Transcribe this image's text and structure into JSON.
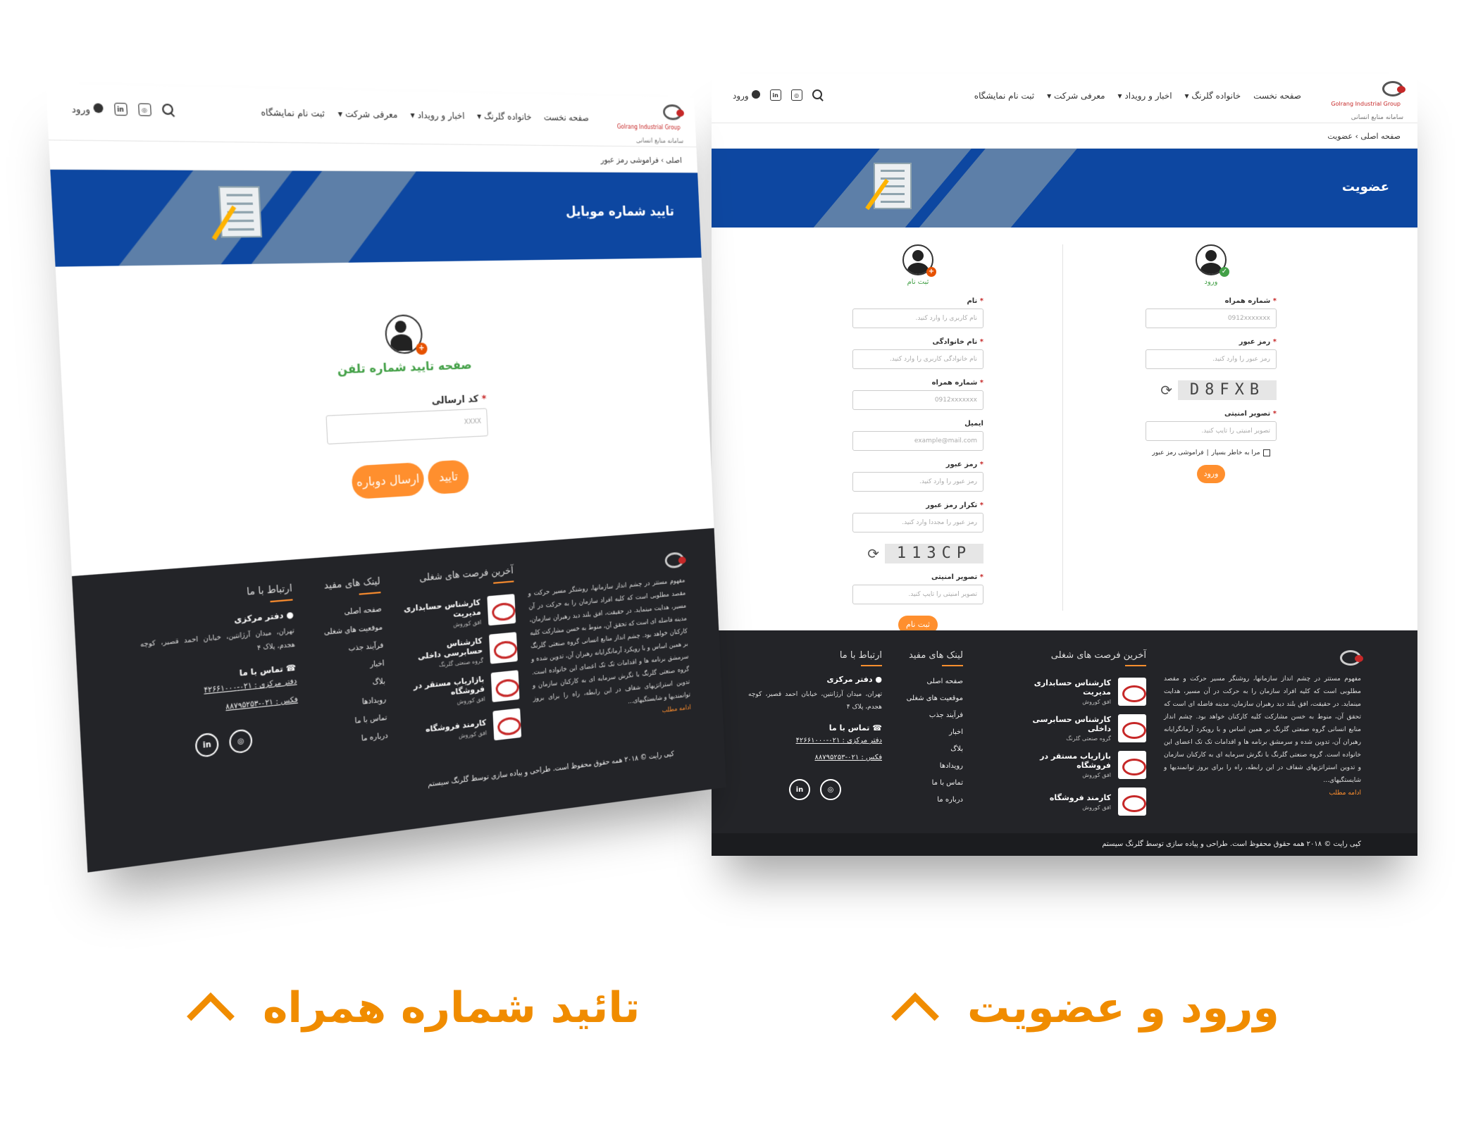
{
  "header": {
    "logo_en": "Golrang Industrial Group",
    "logo_fa": "سامانه منابع انسانی",
    "nav": [
      "صفحه نخست",
      "خانواده گلرنگ",
      "اخبار و رویداد",
      "معرفی شرکت",
      "ثبت نام نمایشگاه"
    ],
    "login": "ورود",
    "linkedin": "in"
  },
  "right_page": {
    "breadcrumb": "صفحه اصلی › عضویت",
    "banner_title": "عضویت",
    "login": {
      "title": "ورود",
      "mobile_label": "شماره همراه",
      "mobile_placeholder": "0912xxxxxxx",
      "password_label": "رمز عبور",
      "password_placeholder": "رمز عبور را وارد کنید.",
      "captcha": "D8FXB",
      "security_label": "تصویر امنیتی",
      "security_placeholder": "تصویر امنیتی را تایپ کنید.",
      "remember": "مرا به خاطر بسپار",
      "forgot": "فراموشی رمز عبور",
      "submit": "ورود"
    },
    "register": {
      "title": "ثبت نام",
      "fields": [
        {
          "label": "نام",
          "placeholder": "نام کاربری را وارد کنید."
        },
        {
          "label": "نام خانوادگی",
          "placeholder": "نام خانوادگی کاربری را وارد کنید."
        },
        {
          "label": "شماره همراه",
          "placeholder": "0912xxxxxxx"
        },
        {
          "label": "ایمیل",
          "placeholder": "example@mail.com"
        },
        {
          "label": "رمز عبور",
          "placeholder": "رمز عبور را وارد کنید."
        },
        {
          "label": "تکرار رمز عبور",
          "placeholder": "رمز عبور را مجددا وارد کنید."
        }
      ],
      "captcha": "113CP",
      "security_label": "تصویر امنیتی",
      "security_placeholder": "تصویر امنیتی را تایپ کنید.",
      "submit": "ثبت نام"
    }
  },
  "left_page": {
    "breadcrumb": "اصلی › فراموشی رمز عبور",
    "banner_title": "تایید شماره موبایل",
    "heading": "صفحه تایید شماره تلفن",
    "code_label": "کد ارسالی",
    "code_placeholder": "XXXX",
    "confirm": "تایید",
    "resend": "ارسال دوباره"
  },
  "footer": {
    "about": "مفهوم مستتر در چشم انداز سازمانها، روشنگر مسیر حرکت و مقصد مطلوبی است که کلیه افراد سازمان را به حرکت در آن مسیر، هدایت مینماید. در حقیقت، افق بلند دید رهبران سازمان، مدینه فاضله ای است که تحقق آن، منوط به خسن مشارکت کلیه کارکنان خواهد بود. چشم انداز منابع انسانی گروه صنعتی گلرنگ بر همین اساس و با رویکرد آرمانگرایانه رهبران آن، تدوین شده و سرمشق برنامه ها و اقدامات تک تک اعضای این خانواده است. گروه صنعتی گلرنگ با نگرش سرمایه ای به کارکنان سازمان و تدوین استراتژیهای شفاف در این رابطه، راه را برای بروز توانمندیها و شایستگیهای...",
    "more": "ادامه مطلب",
    "jobs_title": "آخرین فرصت های شغلی",
    "jobs": [
      {
        "title": "کارشناس حسابداری مدیریت",
        "company": "افق کوروش"
      },
      {
        "title": "کارشناس حسابرسی داخلی",
        "company": "گروه صنعتی گلرنگ"
      },
      {
        "title": "بازاریاب مستقر در فروشگاه",
        "company": "افق کوروش"
      },
      {
        "title": "کارمند فروشگاه",
        "company": "افق کوروش"
      }
    ],
    "links_title": "لینک های مفید",
    "links": [
      "صفحه اصلی",
      "موقعیت های شغلی",
      "فرآیند جذب",
      "اخبار",
      "بلاگ",
      "رویدادها",
      "تماس با ما",
      "درباره ما"
    ],
    "contact_title": "ارتباط با ما",
    "office_title": "دفتر مرکزی",
    "office_address": "تهران، میدان آرژانتین، خیابان احمد قصیر، کوچه هجدم، پلاک ۴",
    "contact_us": "تماس با ما",
    "phone": "دفتر مرکزی : ۰۲۱-۴۲۶۶۱۰۰۰",
    "fax": "فکس : ۰۲۱-۸۸۷۹۵۲۵۳",
    "copyright": "کپی رایت © ۲۰۱۸ همه حقوق محفوظ است. طراحی و پیاده سازی توسط گلرنگ سیستم"
  },
  "captions": {
    "right": "ورود و عضویت",
    "left": "تائید شماره همراه"
  },
  "colors": {
    "banner": "#0d47a1",
    "accent": "#ff8f2e",
    "caption": "#f08c00",
    "footer": "#232428"
  }
}
